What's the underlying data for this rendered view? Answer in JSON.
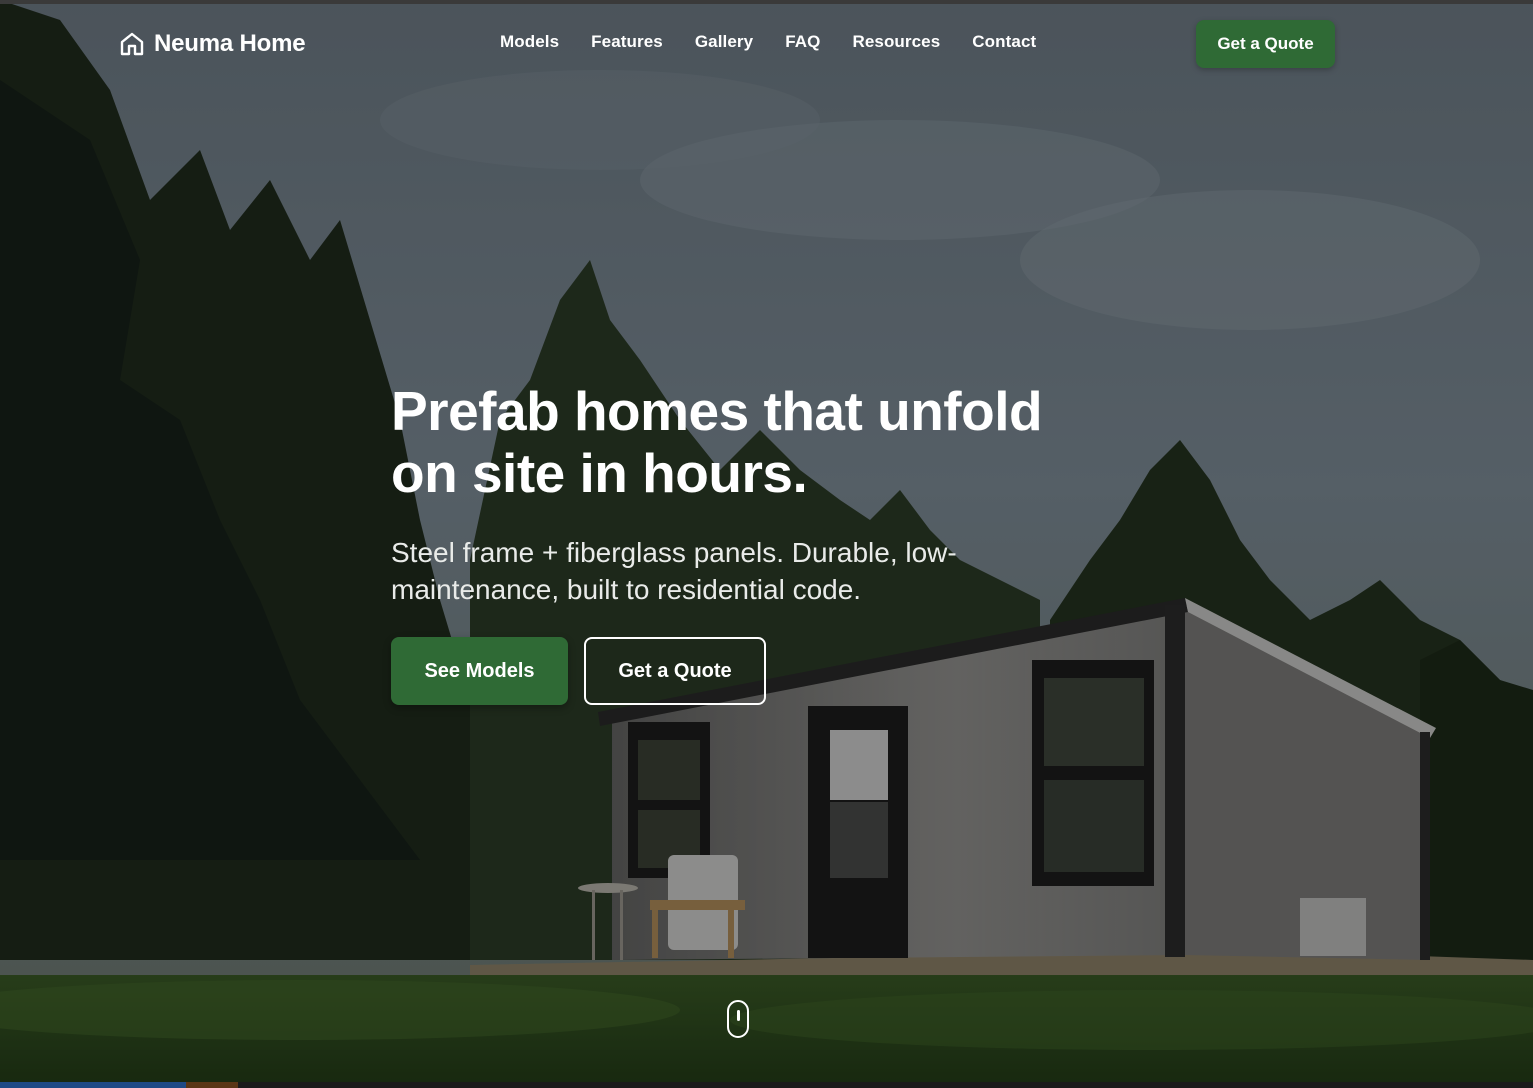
{
  "brand": {
    "name": "Neuma Home",
    "icon": "home-icon"
  },
  "nav": {
    "links": [
      {
        "label": "Models"
      },
      {
        "label": "Features"
      },
      {
        "label": "Gallery"
      },
      {
        "label": "FAQ"
      },
      {
        "label": "Resources"
      },
      {
        "label": "Contact"
      }
    ],
    "cta_label": "Get a Quote"
  },
  "hero": {
    "title": "Prefab homes that unfold on site in hours.",
    "subtitle": "Steel frame + fiberglass panels. Durable, low-maintenance, built to residential code.",
    "primary_cta": "See Models",
    "secondary_cta": "Get a Quote",
    "scroll_indicator_icon": "mouse-scroll-icon"
  },
  "colors": {
    "accent": "#2f6a35",
    "text_on_hero": "#ffffff"
  }
}
